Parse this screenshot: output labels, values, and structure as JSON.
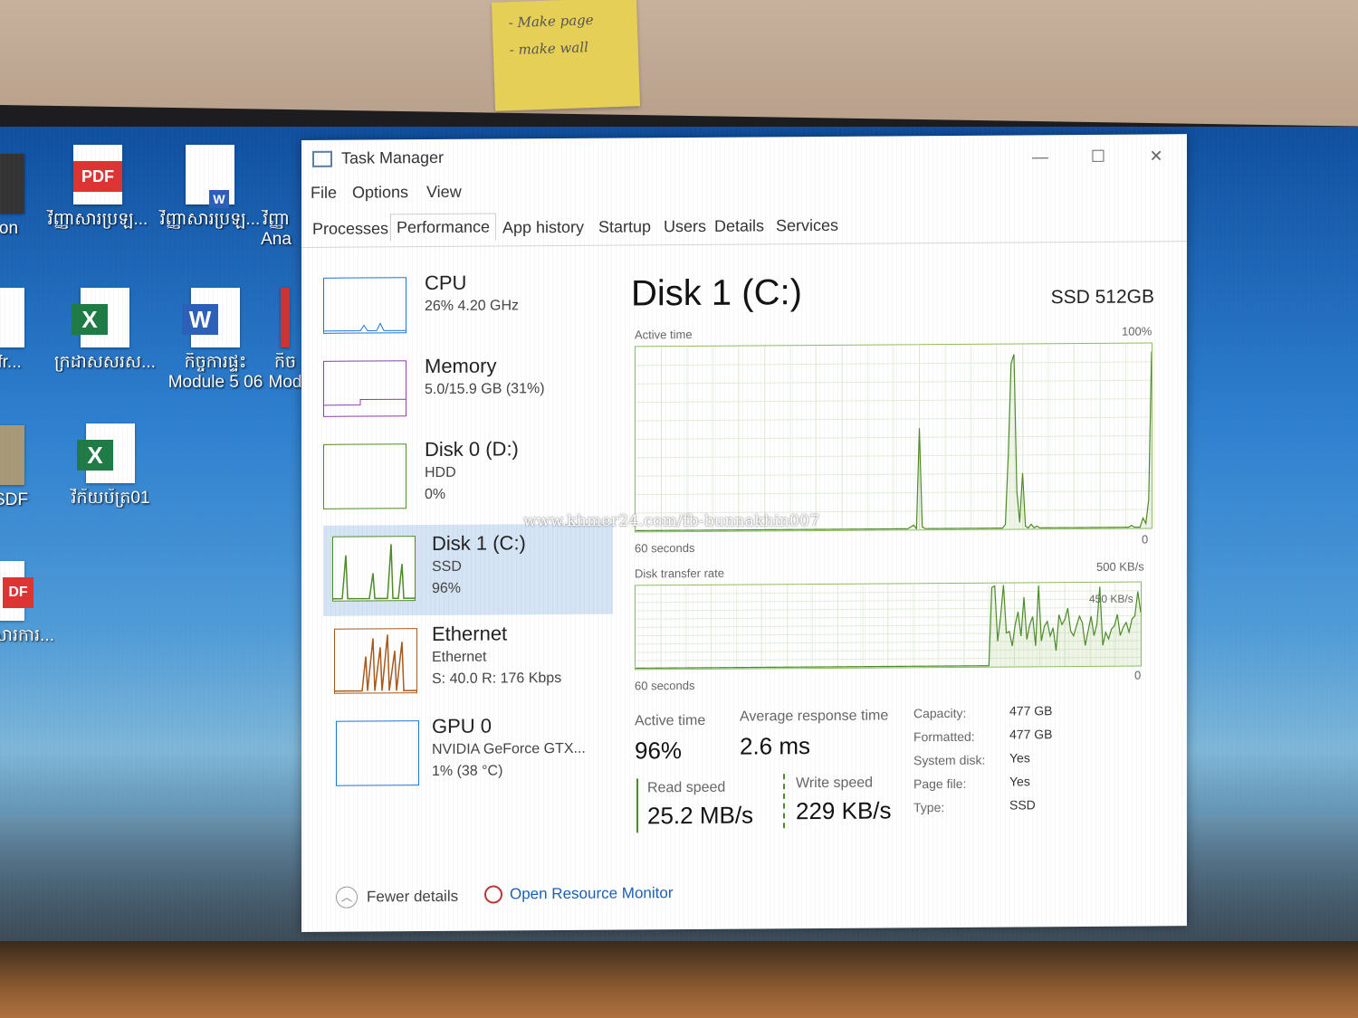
{
  "sticky_note": {
    "line1": "- Make page",
    "line2": "- make wall"
  },
  "desktop": {
    "icons": [
      {
        "label": "ction",
        "type": "partial"
      },
      {
        "label": "វិញ្ញាសារប្រឡ...",
        "type": "pdf",
        "badge": "PDF"
      },
      {
        "label": "វិញ្ញាសារប្រឡ...",
        "type": "word-doc",
        "badge": "W"
      },
      {
        "label": "វិញ្ញា",
        "sub": "Ana",
        "type": "partial"
      },
      {
        "label": "st-fr...",
        "type": "partial"
      },
      {
        "label": "ក្រដាសសរស...",
        "type": "excel",
        "badge": "X"
      },
      {
        "label": "កិច្ចការផ្ទះ",
        "sub": "Module 5 06",
        "type": "word",
        "badge": "W"
      },
      {
        "label": "កិច",
        "sub": "Mod",
        "type": "partial"
      },
      {
        "label": "គ្ននSDF",
        "type": "partial"
      },
      {
        "label": "វិក័យប័ត្រ01",
        "type": "excel",
        "badge": "X"
      },
      {
        "label": "DF",
        "sub": "សារការ...",
        "type": "partial-pdf"
      }
    ]
  },
  "window": {
    "title": "Task Manager",
    "controls": {
      "minimize": "—",
      "maximize": "☐",
      "close": "✕"
    },
    "menu": [
      "File",
      "Options",
      "View"
    ],
    "tabs": [
      "Processes",
      "Performance",
      "App history",
      "Startup",
      "Users",
      "Details",
      "Services"
    ],
    "active_tab": "Performance"
  },
  "resources": [
    {
      "name": "CPU",
      "sub1": "26%  4.20 GHz",
      "sub2": "",
      "color": "#1e74d6"
    },
    {
      "name": "Memory",
      "sub1": "5.0/15.9 GB (31%)",
      "sub2": "",
      "color": "#8b3fa8"
    },
    {
      "name": "Disk 0 (D:)",
      "sub1": "HDD",
      "sub2": "0%",
      "color": "#4d8b2a"
    },
    {
      "name": "Disk 1 (C:)",
      "sub1": "SSD",
      "sub2": "96%",
      "color": "#4d8b2a",
      "selected": true
    },
    {
      "name": "Ethernet",
      "sub1": "Ethernet",
      "sub2": "S: 40.0  R: 176 Kbps",
      "color": "#a75a1c"
    },
    {
      "name": "GPU 0",
      "sub1": "NVIDIA GeForce GTX...",
      "sub2": "1%  (38 °C)",
      "color": "#1e74d6"
    }
  ],
  "detail": {
    "title": "Disk 1 (C:)",
    "model": "SSD 512GB",
    "graph1": {
      "label": "Active time",
      "max": "100%",
      "min": "0",
      "time": "60 seconds"
    },
    "graph2": {
      "label": "Disk transfer rate",
      "max": "500 KB/s",
      "mid": "450 KB/s",
      "min": "0",
      "time": "60 seconds"
    },
    "stats": {
      "active_time_label": "Active time",
      "active_time": "96%",
      "avg_resp_label": "Average response time",
      "avg_resp": "2.6 ms",
      "read_label": "Read speed",
      "read": "25.2 MB/s",
      "write_label": "Write speed",
      "write": "229 KB/s"
    },
    "properties": [
      {
        "k": "Capacity:",
        "v": "477 GB"
      },
      {
        "k": "Formatted:",
        "v": "477 GB"
      },
      {
        "k": "System disk:",
        "v": "Yes"
      },
      {
        "k": "Page file:",
        "v": "Yes"
      },
      {
        "k": "Type:",
        "v": "SSD"
      }
    ]
  },
  "graph_series": {
    "active_time_pct": [
      0,
      0,
      0,
      0,
      0,
      0,
      0,
      0,
      0,
      0,
      0,
      0,
      0,
      0,
      0,
      0,
      0,
      0,
      0,
      0,
      0,
      0,
      0,
      0,
      0,
      0,
      0,
      0,
      0,
      0,
      0,
      0,
      0,
      0,
      0,
      0,
      0,
      0,
      0,
      0,
      0,
      0,
      0,
      0,
      0,
      0,
      0,
      0,
      0,
      0,
      0,
      0,
      0,
      0,
      0,
      0,
      0,
      0,
      0,
      0,
      0,
      0,
      0,
      0,
      0,
      0,
      0,
      0,
      0,
      0,
      0,
      0,
      0,
      0,
      0,
      0,
      0,
      0,
      0,
      0,
      0,
      0,
      0,
      0,
      0,
      0,
      0,
      0,
      0,
      0,
      0,
      0,
      0,
      0,
      0,
      0,
      1,
      2,
      0,
      55,
      1,
      0,
      0,
      0,
      0,
      0,
      0,
      0,
      0,
      0,
      0,
      0,
      0,
      0,
      0,
      0,
      0,
      0,
      0,
      0,
      0,
      0,
      0,
      0,
      0,
      0,
      0,
      0,
      0,
      2,
      40,
      90,
      95,
      20,
      3,
      30,
      1,
      0,
      2,
      0,
      1,
      0,
      0,
      0,
      0,
      0,
      0,
      0,
      0,
      0,
      0,
      0,
      0,
      0,
      0,
      0,
      0,
      0,
      0,
      0,
      0,
      0,
      0,
      0,
      0,
      0,
      0,
      0,
      0,
      0,
      0,
      0,
      0,
      1,
      0,
      0,
      0,
      5,
      2,
      15,
      96
    ],
    "transfer_rate_kbps": [
      0,
      0,
      0,
      0,
      0,
      0,
      0,
      0,
      0,
      0,
      0,
      0,
      0,
      0,
      0,
      0,
      0,
      0,
      0,
      0,
      0,
      0,
      0,
      0,
      0,
      0,
      0,
      0,
      0,
      0,
      0,
      0,
      0,
      0,
      0,
      0,
      0,
      0,
      0,
      0,
      0,
      0,
      0,
      0,
      0,
      0,
      0,
      0,
      0,
      0,
      0,
      0,
      0,
      0,
      0,
      0,
      0,
      0,
      0,
      0,
      0,
      0,
      0,
      0,
      0,
      0,
      0,
      0,
      0,
      0,
      0,
      0,
      0,
      0,
      0,
      0,
      0,
      0,
      0,
      0,
      0,
      0,
      0,
      0,
      0,
      0,
      0,
      0,
      0,
      0,
      0,
      0,
      0,
      0,
      0,
      0,
      0,
      0,
      0,
      0,
      0,
      0,
      0,
      0,
      0,
      0,
      0,
      0,
      0,
      0,
      0,
      0,
      0,
      0,
      0,
      0,
      0,
      0,
      0,
      0,
      0,
      0,
      480,
      490,
      150,
      300,
      495,
      200,
      210,
      120,
      250,
      330,
      180,
      420,
      160,
      250,
      300,
      120,
      490,
      150,
      240,
      270,
      180,
      230,
      90,
      310,
      250,
      280,
      350,
      210,
      180,
      240,
      300,
      260,
      120,
      210,
      300,
      180,
      250,
      480,
      120,
      200,
      160,
      220,
      240,
      310,
      180,
      230,
      260,
      200,
      280,
      300,
      450,
      320
    ]
  },
  "footer": {
    "fewer_details": "Fewer details",
    "open_rm": "Open Resource Monitor"
  },
  "watermark": "www.khmer24.com/fb-bunnakhin007"
}
